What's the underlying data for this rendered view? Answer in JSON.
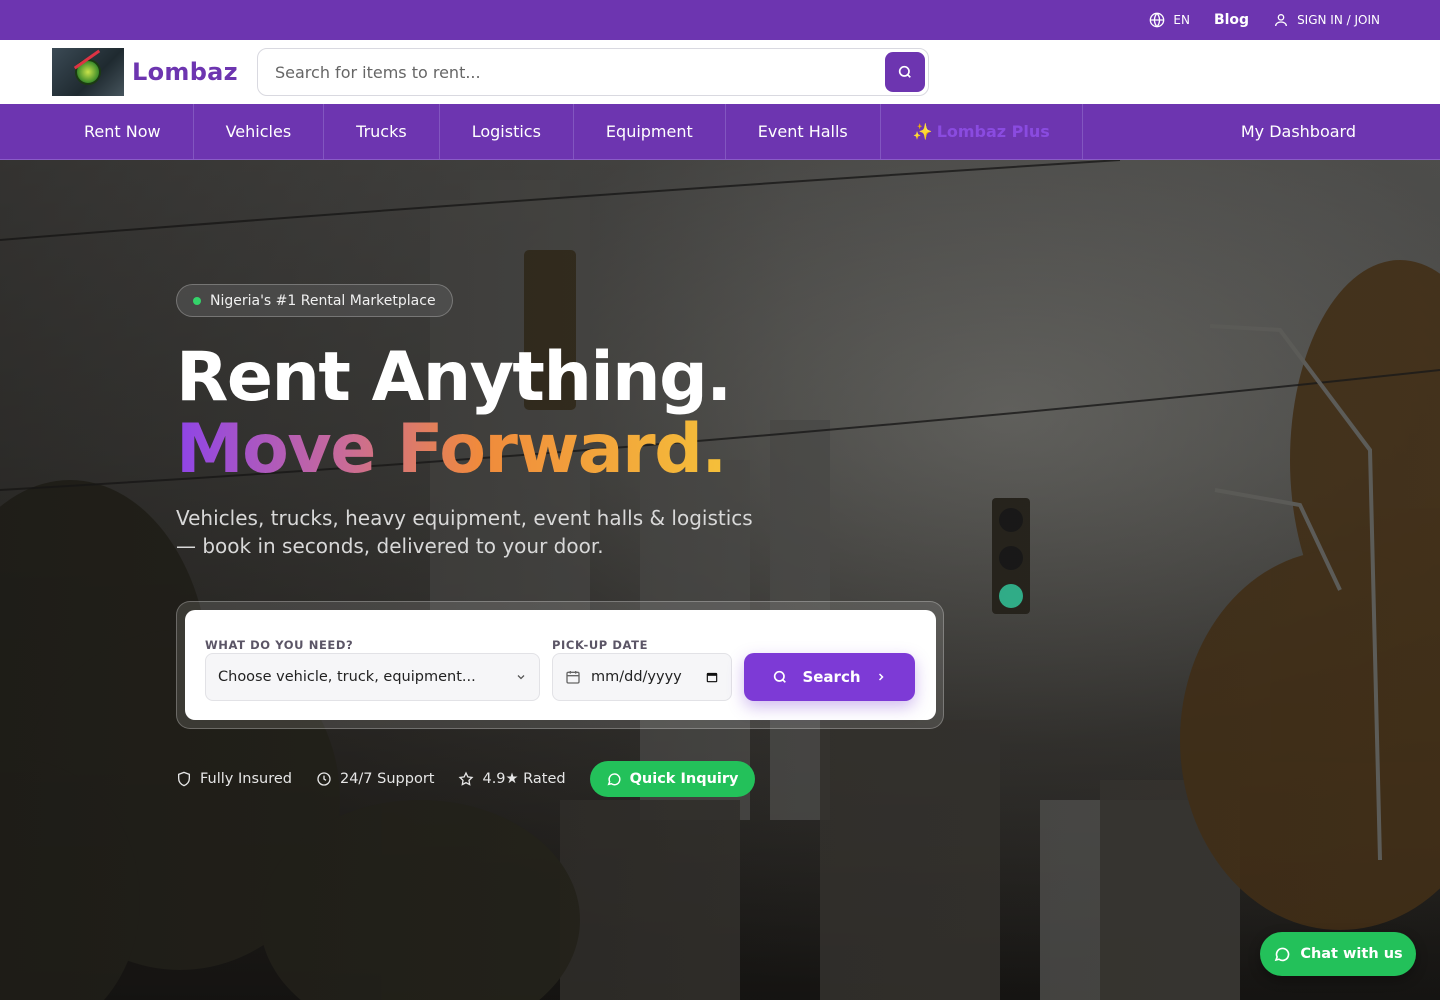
{
  "colors": {
    "brand": "#6d35b0",
    "accent": "#7d3ad6",
    "green": "#23c15a"
  },
  "topbar": {
    "language": "EN",
    "language_icon": "globe-icon",
    "blog": "Blog",
    "signin": "SIGN IN / JOIN",
    "signin_icon": "user-icon"
  },
  "header": {
    "brand_name": "Lombaz",
    "search_placeholder": "Search for items to rent...",
    "search_icon": "search-icon"
  },
  "nav": {
    "items": [
      "Rent Now",
      "Vehicles",
      "Trucks",
      "Logistics",
      "Equipment",
      "Event Halls"
    ],
    "plus": "Lombaz Plus",
    "plus_icon": "✨",
    "dashboard": "My Dashboard"
  },
  "hero": {
    "badge": "Nigeria's #1 Rental Marketplace",
    "headline_1": "Rent Anything.",
    "headline_2": "Move Forward.",
    "subtitle": "Vehicles, trucks, heavy equipment, event halls & logistics — book in seconds, delivered to your door."
  },
  "form": {
    "need_label": "WHAT DO YOU NEED?",
    "need_value": "Choose vehicle, truck, equipment...",
    "date_label": "PICK-UP DATE",
    "date_value": "mm/dd/yyyy",
    "search_button": "Search"
  },
  "trust": {
    "insured": "Fully Insured",
    "support": "24/7 Support",
    "rated": "4.9★ Rated",
    "quick": "Quick Inquiry"
  },
  "chat": {
    "label": "Chat with us"
  }
}
